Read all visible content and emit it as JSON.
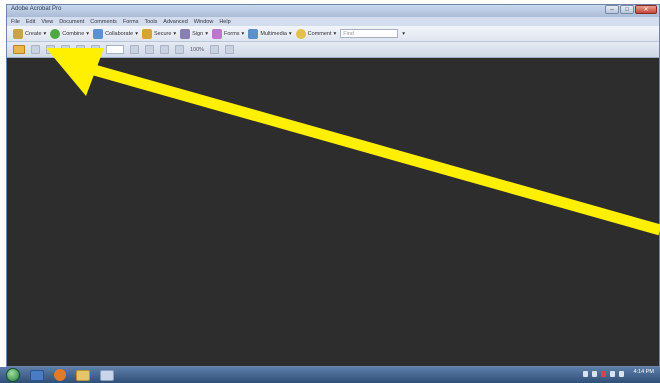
{
  "window": {
    "title": "Adobe Acrobat Pro"
  },
  "menubar": {
    "items": [
      "File",
      "Edit",
      "View",
      "Document",
      "Comments",
      "Forms",
      "Tools",
      "Advanced",
      "Window",
      "Help"
    ]
  },
  "toolbar": {
    "buttons": [
      {
        "label": "Create",
        "icon": "create-icon",
        "color": "#c8a448"
      },
      {
        "label": "Combine",
        "icon": "combine-icon",
        "color": "#4fa843"
      },
      {
        "label": "Collaborate",
        "icon": "collaborate-icon",
        "color": "#5b8fd6"
      },
      {
        "label": "Secure",
        "icon": "lock-icon",
        "color": "#d6a531"
      },
      {
        "label": "Sign",
        "icon": "pen-icon",
        "color": "#8a7fb5"
      },
      {
        "label": "Forms",
        "icon": "forms-icon",
        "color": "#b978c9"
      },
      {
        "label": "Multimedia",
        "icon": "multimedia-icon",
        "color": "#5d8fc9"
      },
      {
        "label": "Comment",
        "icon": "comment-icon",
        "color": "#e2c04b"
      }
    ],
    "find_placeholder": "Find"
  },
  "nav_toolbar": {
    "zoom": "100%"
  },
  "taskbar": {
    "clock_time": "4:14 PM"
  },
  "annotation": {
    "arrow_color": "#ffef00"
  }
}
